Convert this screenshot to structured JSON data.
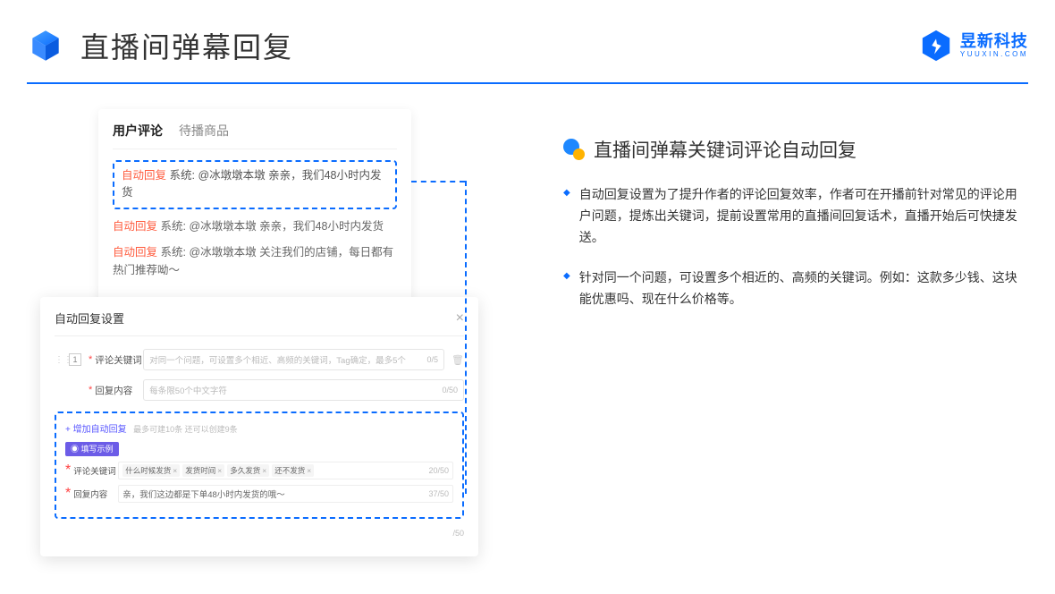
{
  "header": {
    "title": "直播间弹幕回复",
    "brand_cn": "昱新科技",
    "brand_en": "YUUXIN.COM"
  },
  "comments_card": {
    "tabs": [
      "用户评论",
      "待播商品"
    ],
    "highlighted": {
      "tag": "自动回复",
      "text": "系统: @冰墩墩本墩 亲亲，我们48小时内发货"
    },
    "list": [
      {
        "tag": "自动回复",
        "text": "系统: @冰墩墩本墩 亲亲，我们48小时内发货"
      },
      {
        "tag": "自动回复",
        "text": "系统: @冰墩墩本墩 关注我们的店铺，每日都有热门推荐呦～"
      }
    ]
  },
  "settings_card": {
    "title": "自动回复设置",
    "index": "1",
    "row1": {
      "label": "评论关键词",
      "placeholder": "对同一个问题，可设置多个相近、高频的关键词，Tag确定，最多5个",
      "counter": "0/5"
    },
    "row2": {
      "label": "回复内容",
      "placeholder": "每条限50个中文字符",
      "counter": "0/50"
    },
    "add_link": "+ 增加自动回复",
    "add_hint": "最多可建10条 还可以创建9条",
    "example_badge": "◉ 填写示例",
    "ex_row1": {
      "label": "评论关键词",
      "chips": [
        "什么时候发货",
        "发货时间",
        "多久发货",
        "还不发货"
      ],
      "counter": "20/50"
    },
    "ex_row2": {
      "label": "回复内容",
      "value": "亲，我们这边都是下单48小时内发货的哦～",
      "counter": "37/50"
    },
    "bottom_counter": "/50"
  },
  "right": {
    "section_title": "直播间弹幕关键词评论自动回复",
    "bullets": [
      "自动回复设置为了提升作者的评论回复效率，作者可在开播前针对常见的评论用户问题，提炼出关键词，提前设置常用的直播间回复话术，直播开始后可快捷发送。",
      "针对同一个问题，可设置多个相近的、高频的关键词。例如：这款多少钱、这块能优惠吗、现在什么价格等。"
    ]
  }
}
